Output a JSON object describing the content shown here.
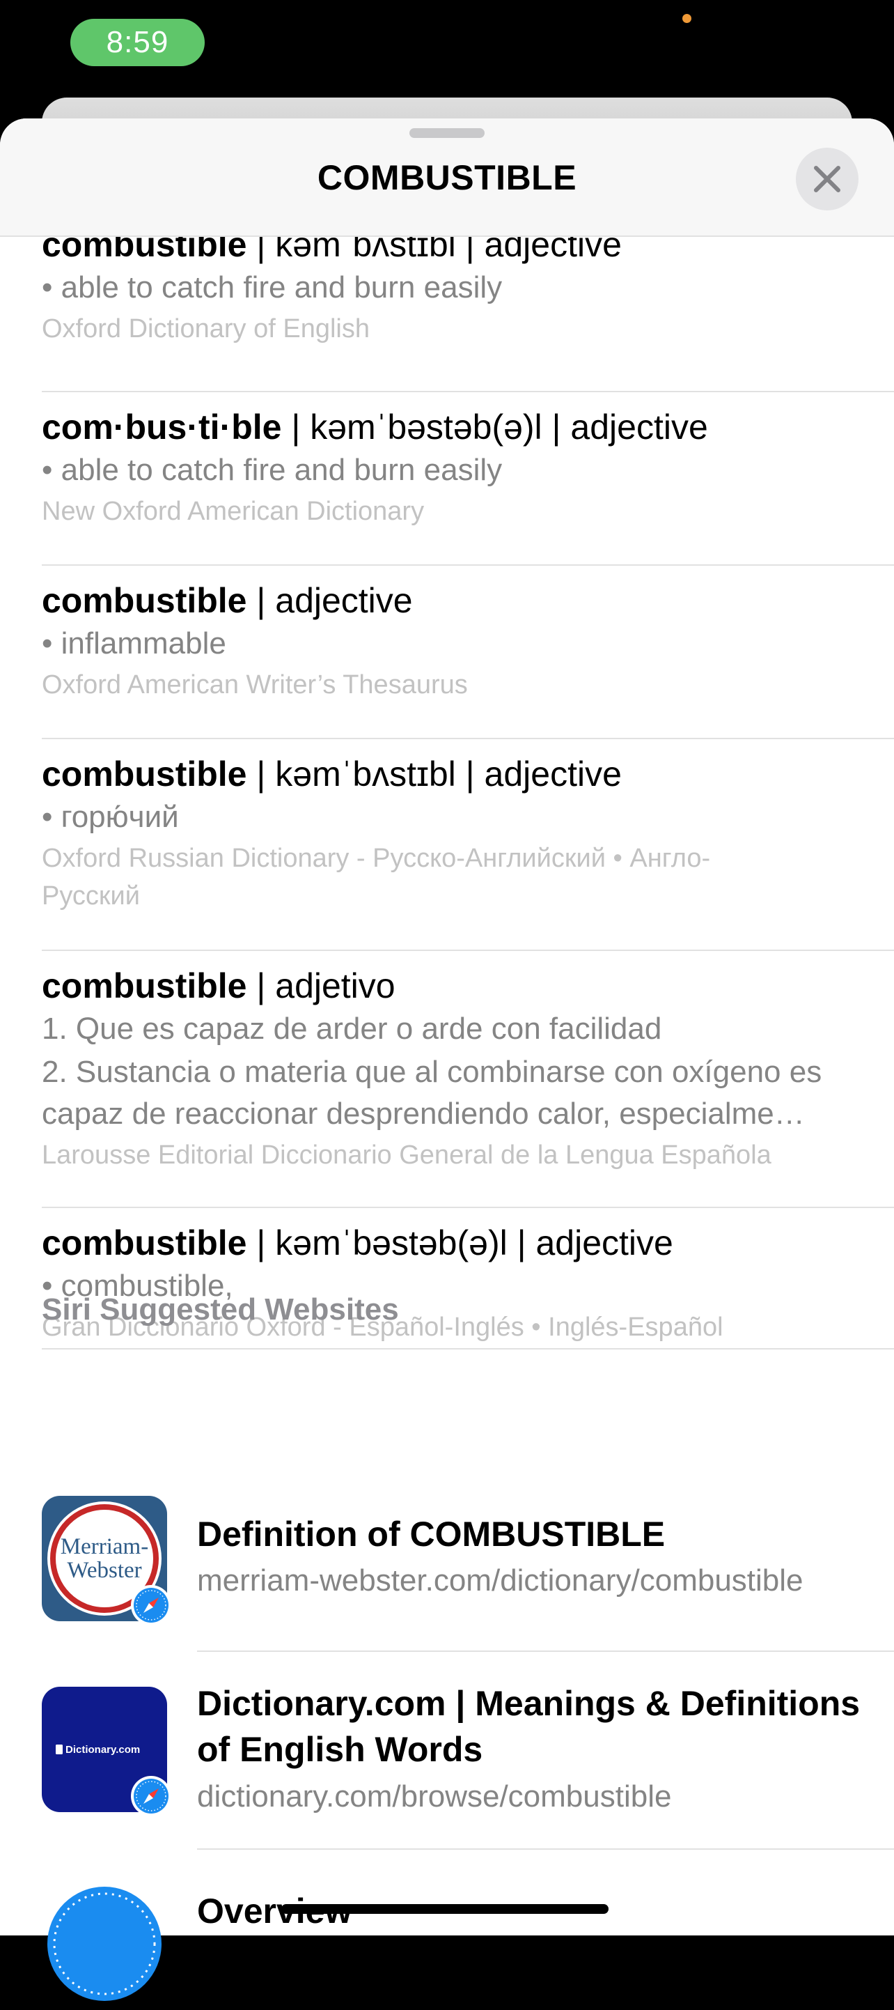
{
  "status_bar": {
    "time": "8:59"
  },
  "sheet": {
    "title": "COMBUSTIBLE",
    "close_icon": "xmark-icon"
  },
  "entries": [
    {
      "word": "combustible",
      "rest": "  |  kəmˈbʌstɪbl  |  adjective",
      "lines": [
        "• able to catch fire and burn easily"
      ],
      "source": "Oxford Dictionary of English"
    },
    {
      "word": "com·bus·ti·ble",
      "rest": "  |  kəmˈbəstəb(ə)l  |  adjective",
      "lines": [
        "• able to catch fire and burn easily"
      ],
      "source": "New Oxford American Dictionary"
    },
    {
      "word": "combustible",
      "rest": "  |  adjective",
      "lines": [
        "• inflammable"
      ],
      "source": "Oxford American Writer’s Thesaurus"
    },
    {
      "word": "combustible",
      "rest": "  |  kəmˈbʌstɪbl  |  adjective",
      "lines": [
        "• горю́чий"
      ],
      "source": "Oxford Russian Dictionary - Русско-Английский • Англо-Русский"
    },
    {
      "word": "combustible",
      "rest": "  |  adjetivo",
      "lines": [
        "1. Que es capaz de arder o arde con facilidad",
        "2. Sustancia o materia que al combinarse con oxígeno es capaz de reaccionar desprendiendo calor, especialme…"
      ],
      "source": "Larousse Editorial Diccionario General de la Lengua Española"
    },
    {
      "word": "combustible",
      "rest": "  |  kəmˈbəstəb(ə)l  |  adjective",
      "lines": [
        "• combustible,"
      ],
      "source": "Gran Diccionario Oxford - Español-Inglés • Inglés-Español"
    }
  ],
  "suggested": {
    "section_title": "Siri Suggested Websites",
    "sites": [
      {
        "title": "Definition of COMBUSTIBLE",
        "url": "merriam-webster.com/dictionary/combustible",
        "icon": "merriam-webster-logo",
        "logo_line1": "Merriam-",
        "logo_line2": "Webster"
      },
      {
        "title": "Dictionary.com | Meanings & Definitions of English Words",
        "url": "dictionary.com/browse/combustible",
        "icon": "dictionary-com-logo",
        "logo_text": "Dictionary.com"
      },
      {
        "title": "Overview",
        "icon": "safari-compass-icon"
      }
    ],
    "badge_icon": "safari-compass-badge-icon"
  },
  "colors": {
    "status_pill": "#5fc66a",
    "secondary_text": "#848484",
    "source_text": "#c2c2c2",
    "merriam_blue": "#2e5b87",
    "merriam_red": "#c62828",
    "dictionary_blue": "#0f1b8c",
    "safari_blue": "#1a8cf0"
  }
}
